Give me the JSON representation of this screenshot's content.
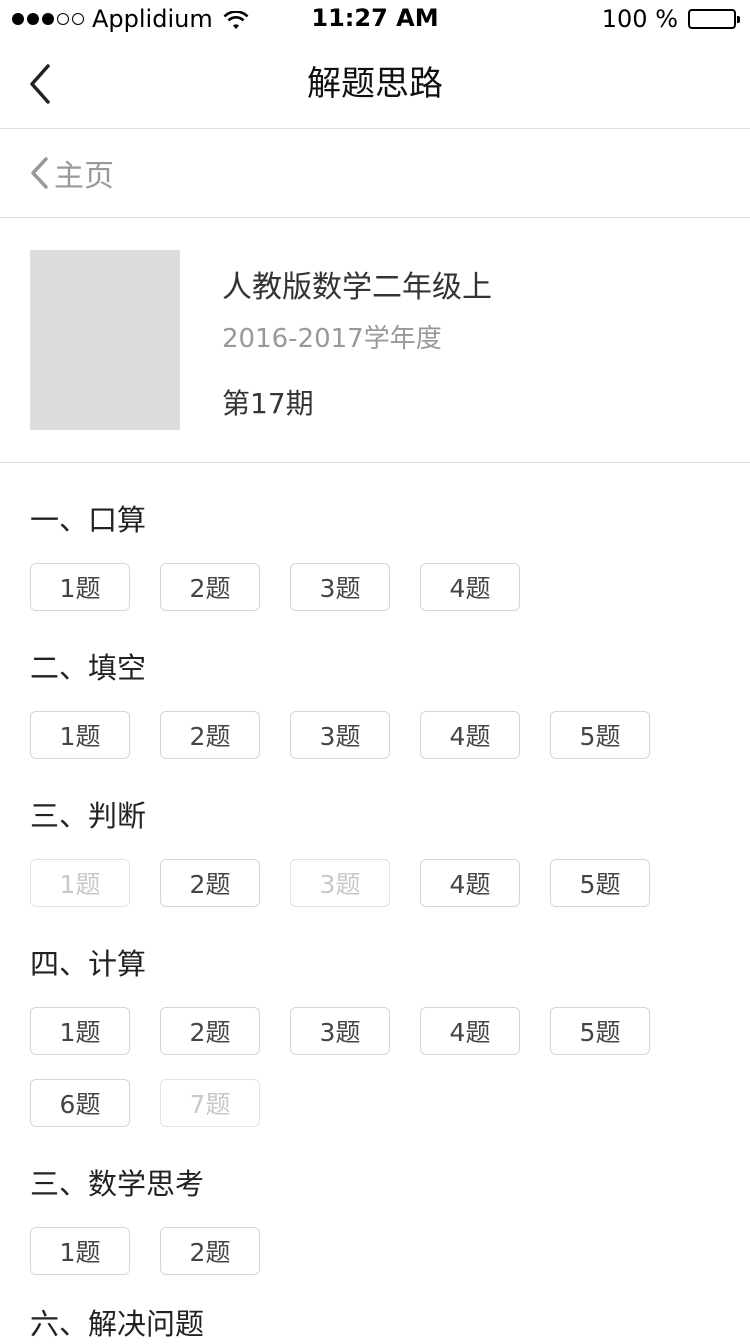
{
  "status_bar": {
    "carrier": "Applidium",
    "time": "11:27 AM",
    "battery_text": "100 %",
    "battery_level": 1.0
  },
  "nav": {
    "title": "解题思路"
  },
  "breadcrumb": {
    "label": "主页"
  },
  "book": {
    "title": "人教版数学二年级上",
    "year": "2016-2017学年度",
    "issue": "第17期"
  },
  "sections": [
    {
      "title": "一、口算",
      "rows": [
        [
          {
            "label": "1题",
            "enabled": true
          },
          {
            "label": "2题",
            "enabled": true
          },
          {
            "label": "3题",
            "enabled": true
          },
          {
            "label": "4题",
            "enabled": true
          }
        ]
      ]
    },
    {
      "title": "二、填空",
      "rows": [
        [
          {
            "label": "1题",
            "enabled": true
          },
          {
            "label": "2题",
            "enabled": true
          },
          {
            "label": "3题",
            "enabled": true
          },
          {
            "label": "4题",
            "enabled": true
          },
          {
            "label": "5题",
            "enabled": true
          }
        ]
      ]
    },
    {
      "title": "三、判断",
      "rows": [
        [
          {
            "label": "1题",
            "enabled": false
          },
          {
            "label": "2题",
            "enabled": true
          },
          {
            "label": "3题",
            "enabled": false
          },
          {
            "label": "4题",
            "enabled": true
          },
          {
            "label": "5题",
            "enabled": true
          }
        ]
      ]
    },
    {
      "title": "四、计算",
      "rows": [
        [
          {
            "label": "1题",
            "enabled": true
          },
          {
            "label": "2题",
            "enabled": true
          },
          {
            "label": "3题",
            "enabled": true
          },
          {
            "label": "4题",
            "enabled": true
          },
          {
            "label": "5题",
            "enabled": true
          }
        ],
        [
          {
            "label": "6题",
            "enabled": true
          },
          {
            "label": "7题",
            "enabled": false
          }
        ]
      ]
    },
    {
      "title": "三、数学思考",
      "rows": [
        [
          {
            "label": "1题",
            "enabled": true
          },
          {
            "label": "2题",
            "enabled": true
          }
        ]
      ]
    },
    {
      "title": "六、解决问题",
      "rows": []
    }
  ]
}
